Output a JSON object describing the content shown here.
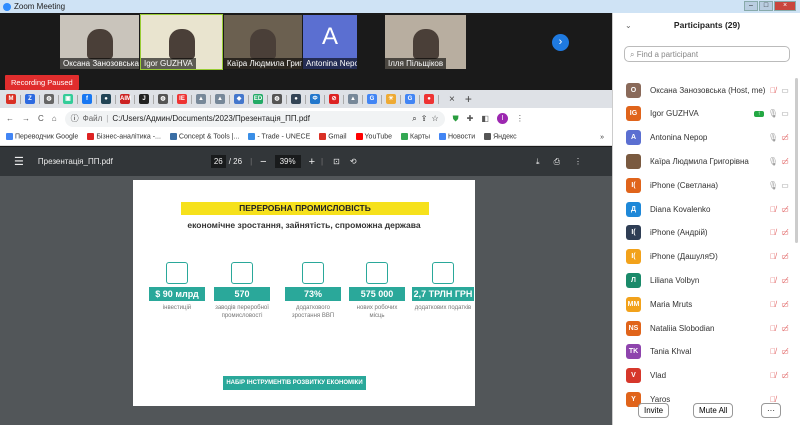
{
  "window": {
    "title": "Zoom Meeting"
  },
  "videos": [
    {
      "name": "Оксана Занозовська",
      "bg": "#c9c4bb"
    },
    {
      "name": "Igor GUZHVA",
      "bg": "#e9e4cf"
    },
    {
      "name": "Каїра Людмила Григорі...",
      "bg": "#6b6050"
    },
    {
      "name": "Antonina Nepop",
      "initial": "A",
      "bg": "#5b6fd1"
    },
    {
      "name": "Ілля Пільщіков",
      "bg": "#b8aea0"
    }
  ],
  "recording": "Recording Paused",
  "browser": {
    "tabs": [
      {
        "g": "M",
        "c": "#d93025"
      },
      {
        "g": "Z",
        "c": "#2d6ae0"
      },
      {
        "g": "◍",
        "c": "#666"
      },
      {
        "g": "▣",
        "c": "#3c9"
      },
      {
        "g": "f",
        "c": "#1877f2"
      },
      {
        "g": "●",
        "c": "#245"
      },
      {
        "g": "AIM",
        "c": "#c22"
      },
      {
        "g": "J",
        "c": "#222"
      },
      {
        "g": "◍",
        "c": "#555"
      },
      {
        "g": "IE",
        "c": "#e33"
      },
      {
        "g": "▲",
        "c": "#789"
      },
      {
        "g": "▲",
        "c": "#789"
      },
      {
        "g": "◆",
        "c": "#47c"
      },
      {
        "g": "ED",
        "c": "#2a6"
      },
      {
        "g": "◍",
        "c": "#555"
      },
      {
        "g": "●",
        "c": "#345"
      },
      {
        "g": "Ф",
        "c": "#27c"
      },
      {
        "g": "⊘",
        "c": "#d22"
      },
      {
        "g": "▲",
        "c": "#789"
      },
      {
        "g": "G",
        "c": "#4285f4"
      },
      {
        "g": "☀",
        "c": "#ea3"
      },
      {
        "g": "G",
        "c": "#4285f4"
      },
      {
        "g": "●",
        "c": "#e33"
      }
    ],
    "new_tab": "+",
    "close_tab": "×",
    "file_label": "Файл",
    "url": "C:/Users/Админ/Documents/2023/Презентація_ПП.pdf",
    "profile_initial": "I",
    "bookmarks": [
      {
        "label": "Переводчик Google",
        "c": "#4285f4"
      },
      {
        "label": "Бізнес-аналітика -...",
        "c": "#d22"
      },
      {
        "label": "Concept & Tools |...",
        "c": "#3a6ea5"
      },
      {
        "label": "- Trade - UNECE",
        "c": "#3a8ee6"
      },
      {
        "label": "Gmail",
        "c": "#d93025"
      },
      {
        "label": "YouTube",
        "c": "#f00"
      },
      {
        "label": "Карты",
        "c": "#34a853"
      },
      {
        "label": "Новости",
        "c": "#4285f4"
      },
      {
        "label": "Яндекс",
        "c": "#555"
      }
    ],
    "more": "»"
  },
  "pdf": {
    "filename": "Презентація_ПП.pdf",
    "page_current": "26",
    "page_total": "/ 26",
    "zoom": "39%",
    "slide": {
      "title": "ПЕРЕРОБНА ПРОМИСЛОВІСТЬ",
      "subtitle": "економічне зростання, зайнятість, спроможна держава",
      "stats": [
        {
          "value": "$ 90 млрд",
          "caption": "інвестицій"
        },
        {
          "value": "570",
          "caption": "заводів переробної промисловості"
        },
        {
          "value": "73%",
          "caption": "додаткового зростання ВВП"
        },
        {
          "value": "575 000",
          "caption": "нових робочих місць"
        },
        {
          "value": "2,7 ТРЛН ГРН",
          "caption": "додаткових податків"
        }
      ],
      "button": "НАБІР ІНСТРУМЕНТІВ РОЗВИТКУ ЕКОНОМІКИ"
    }
  },
  "participants": {
    "title": "Participants (29)",
    "search_placeholder": "Find a participant",
    "list": [
      {
        "initials": "O",
        "name": "Оксана Занозовська (Host, me)",
        "color": "#8a6a5a",
        "mic": "muted",
        "cam": "on"
      },
      {
        "initials": "IG",
        "name": "Igor GUZHVA",
        "color": "#e0641b",
        "mic": "on",
        "cam": "on",
        "share": true
      },
      {
        "initials": "A",
        "name": "Antonina Nepop",
        "color": "#5b6fd1",
        "mic": "on",
        "cam": "off"
      },
      {
        "initials": "",
        "name": "Каїра Людмила Григорівна",
        "color": "#7a5a40",
        "mic": "on",
        "cam": "off"
      },
      {
        "initials": "I(",
        "name": "iPhone (Светлана)",
        "color": "#e0641b",
        "mic": "on",
        "cam": "on"
      },
      {
        "initials": "Д",
        "name": "Diana Kovalenko",
        "color": "#1e88d8",
        "mic": "muted",
        "cam": "off"
      },
      {
        "initials": "I(",
        "name": "iPhone (Андрій)",
        "color": "#2f3e55",
        "mic": "muted",
        "cam": "off"
      },
      {
        "initials": "I(",
        "name": "iPhone (Дашуля⅁)",
        "color": "#f2a21b",
        "mic": "muted",
        "cam": "off"
      },
      {
        "initials": "Л",
        "name": "Liliana Volbyn",
        "color": "#1a8a6a",
        "mic": "muted",
        "cam": "off"
      },
      {
        "initials": "MM",
        "name": "Maria Mruts",
        "color": "#f2a21b",
        "mic": "muted",
        "cam": "off"
      },
      {
        "initials": "NS",
        "name": "Nataliia Slobodian",
        "color": "#e0641b",
        "mic": "muted",
        "cam": "off"
      },
      {
        "initials": "TK",
        "name": "Tania Khval",
        "color": "#8e44ad",
        "mic": "muted",
        "cam": "off"
      },
      {
        "initials": "V",
        "name": "Vlad",
        "color": "#d6372b",
        "mic": "muted",
        "cam": "off"
      },
      {
        "initials": "Y",
        "name": "Yaros",
        "color": "#e0641b",
        "mic": "muted",
        "cam": "none"
      }
    ],
    "invite": "Invite",
    "mute_all": "Mute All",
    "more": "···"
  }
}
